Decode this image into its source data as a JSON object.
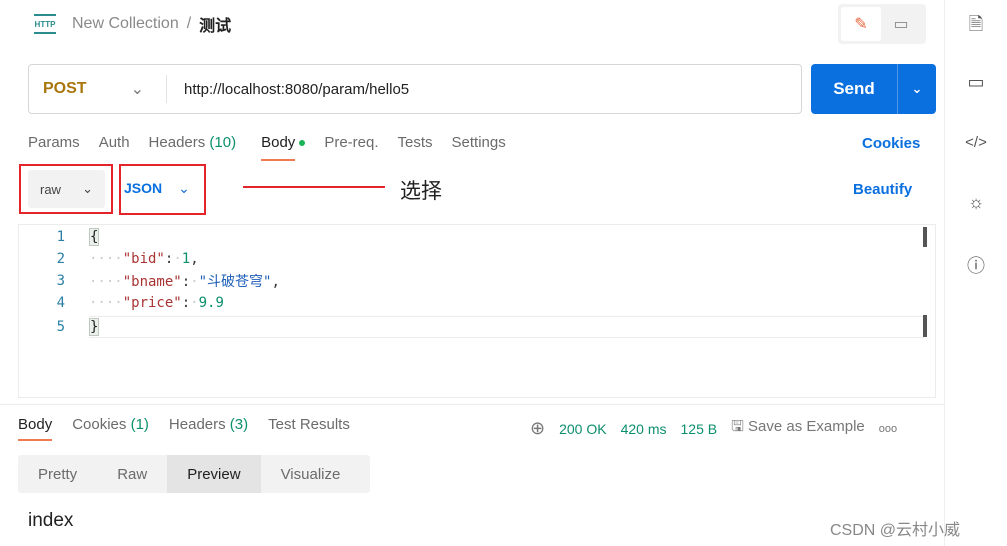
{
  "breadcrumb": {
    "icon": "http-icon",
    "collection": "New Collection",
    "separator": "/",
    "request": "测试"
  },
  "top_actions": [
    {
      "icon": "pencil-icon"
    },
    {
      "icon": "comment-icon"
    }
  ],
  "right_sidebar": [
    {
      "icon": "document-icon"
    },
    {
      "icon": "comment-icon"
    },
    {
      "icon": "code-icon"
    },
    {
      "icon": "lightbulb-icon"
    },
    {
      "icon": "info-icon"
    }
  ],
  "request": {
    "method": "POST",
    "url": "http://localhost:8080/param/hello5",
    "send_label": "Send"
  },
  "tabs": [
    {
      "label": "Params"
    },
    {
      "label": "Auth"
    },
    {
      "label": "Headers",
      "count": "(10)"
    },
    {
      "label": "Body",
      "active": true
    },
    {
      "label": "Pre-req."
    },
    {
      "label": "Tests"
    },
    {
      "label": "Settings"
    }
  ],
  "cookies_label": "Cookies",
  "body": {
    "mode": "raw",
    "language": "JSON",
    "beautify_label": "Beautify",
    "annotation": "选择"
  },
  "editor": {
    "lines": [
      "1",
      "2",
      "3",
      "4",
      "5"
    ],
    "open": "{",
    "close": "}",
    "k1": "\"bid\"",
    "v1": "1",
    "k2": "\"bname\"",
    "v2": "\"斗破苍穹\"",
    "k3": "\"price\"",
    "v3": "9.9"
  },
  "response": {
    "tabs": [
      {
        "label": "Body",
        "active": true
      },
      {
        "label": "Cookies",
        "count": "(1)"
      },
      {
        "label": "Headers",
        "count": "(3)"
      },
      {
        "label": "Test Results"
      }
    ],
    "status": "200 OK",
    "time": "420 ms",
    "size": "125 B",
    "save_label": "Save as Example",
    "views": [
      "Pretty",
      "Raw",
      "Preview",
      "Visualize"
    ],
    "active_view": "Preview",
    "output": "index"
  },
  "watermark": "CSDN @云村小威",
  "colors": {
    "accent": "#0a6fdf",
    "method": "#a8760c",
    "success": "#0c8f6d",
    "annotation": "#e3242b",
    "active_tab": "#f27a53"
  }
}
